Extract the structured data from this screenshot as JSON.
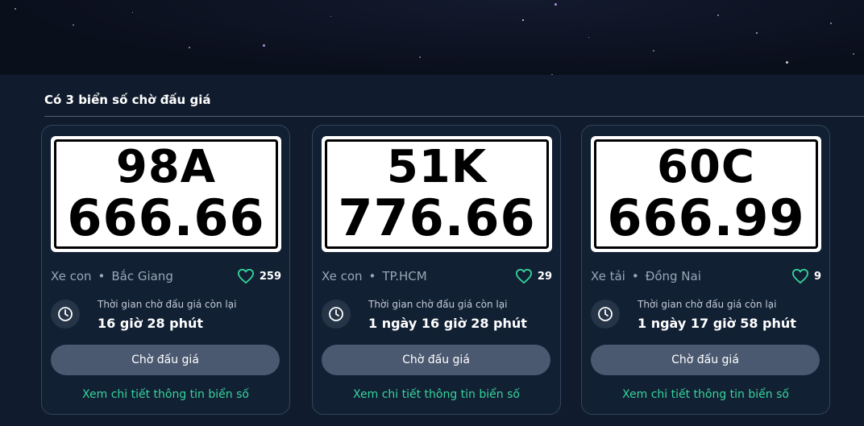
{
  "heading": "Có 3 biển số chờ đấu giá",
  "colors": {
    "accent": "#36d39b",
    "button_bg": "#4a5870",
    "card_border": "#33445c",
    "page_bg": "#101c2d"
  },
  "cards": [
    {
      "plate_line1": "98A",
      "plate_line2": "666.66",
      "vehicle_type": "Xe con",
      "separator": "•",
      "region": "Bắc Giang",
      "like_icon": "heart-icon",
      "likes": "259",
      "time_label": "Thời gian chờ đấu giá còn lại",
      "time_value": "16 giờ 28 phút",
      "button_label": "Chờ đấu giá",
      "link_label": "Xem chi tiết thông tin biển số"
    },
    {
      "plate_line1": "51K",
      "plate_line2": "776.66",
      "vehicle_type": "Xe con",
      "separator": "•",
      "region": "TP.HCM",
      "like_icon": "heart-icon",
      "likes": "29",
      "time_label": "Thời gian chờ đấu giá còn lại",
      "time_value": "1 ngày 16 giờ 28 phút",
      "button_label": "Chờ đấu giá",
      "link_label": "Xem chi tiết thông tin biển số"
    },
    {
      "plate_line1": "60C",
      "plate_line2": "666.99",
      "vehicle_type": "Xe tải",
      "separator": "•",
      "region": "Đồng Nai",
      "like_icon": "heart-icon",
      "likes": "9",
      "time_label": "Thời gian chờ đấu giá còn lại",
      "time_value": "1 ngày 17 giờ 58 phút",
      "button_label": "Chờ đấu giá",
      "link_label": "Xem chi tiết thông tin biển số"
    }
  ]
}
